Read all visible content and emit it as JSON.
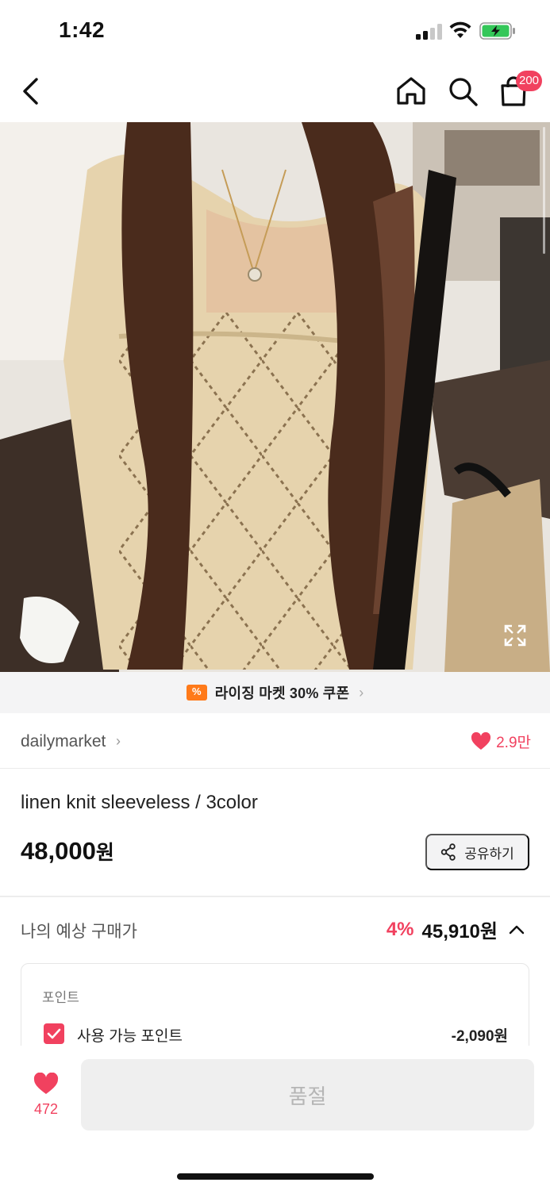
{
  "status": {
    "time": "1:42"
  },
  "header": {
    "cart_count": "200"
  },
  "image": {
    "alt": "linen knit sleeveless / 3color"
  },
  "coupon": {
    "text": "라이징 마켓 30% 쿠폰"
  },
  "shop": {
    "name": "dailymarket",
    "likes": "2.9만"
  },
  "product": {
    "title": "linen knit sleeveless / 3color",
    "price": "48,000",
    "price_unit": "원",
    "share_label": "공유하기"
  },
  "expected": {
    "label": "나의 예상 구매가",
    "discount": "4%",
    "price": "45,910원"
  },
  "points": {
    "title": "포인트",
    "label": "사용 가능 포인트",
    "value": "-2,090원"
  },
  "bottom": {
    "likes": "472",
    "button_label": "품절"
  },
  "colors": {
    "accent": "#f1415f",
    "coupon": "#ff7a1a"
  }
}
